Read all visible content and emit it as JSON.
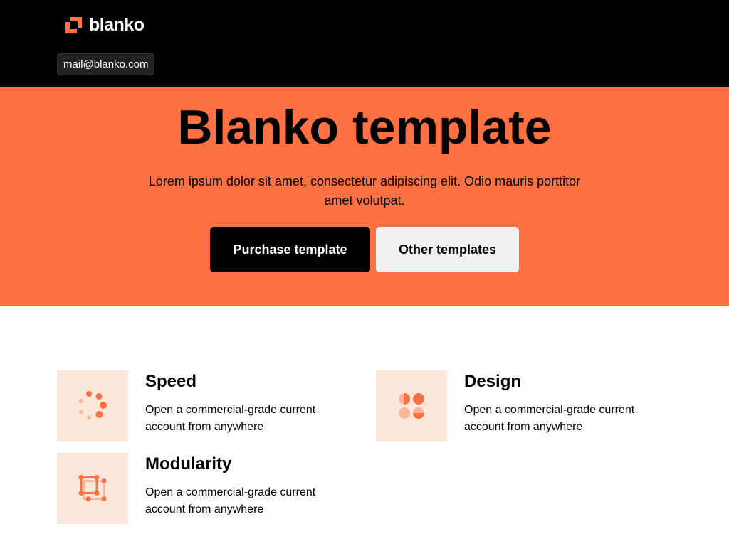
{
  "brand": {
    "name": "blanko",
    "logo_icon": "blanko-logo-icon",
    "accent_color": "#ff7043"
  },
  "header": {
    "email": "mail@blanko.com"
  },
  "hero": {
    "title": "Blanko template",
    "subtitle": "Lorem ipsum dolor sit amet, consectetur adipiscing elit. Odio mauris porttitor amet volutpat.",
    "primary_button": "Purchase template",
    "secondary_button": "Other templates"
  },
  "features": [
    {
      "icon": "speed-icon",
      "title": "Speed",
      "description": "Open a commercial-grade current account from anywhere"
    },
    {
      "icon": "design-icon",
      "title": "Design",
      "description": "Open a commercial-grade current account from anywhere"
    },
    {
      "icon": "modularity-icon",
      "title": "Modularity",
      "description": "Open a commercial-grade current account from anywhere"
    }
  ]
}
